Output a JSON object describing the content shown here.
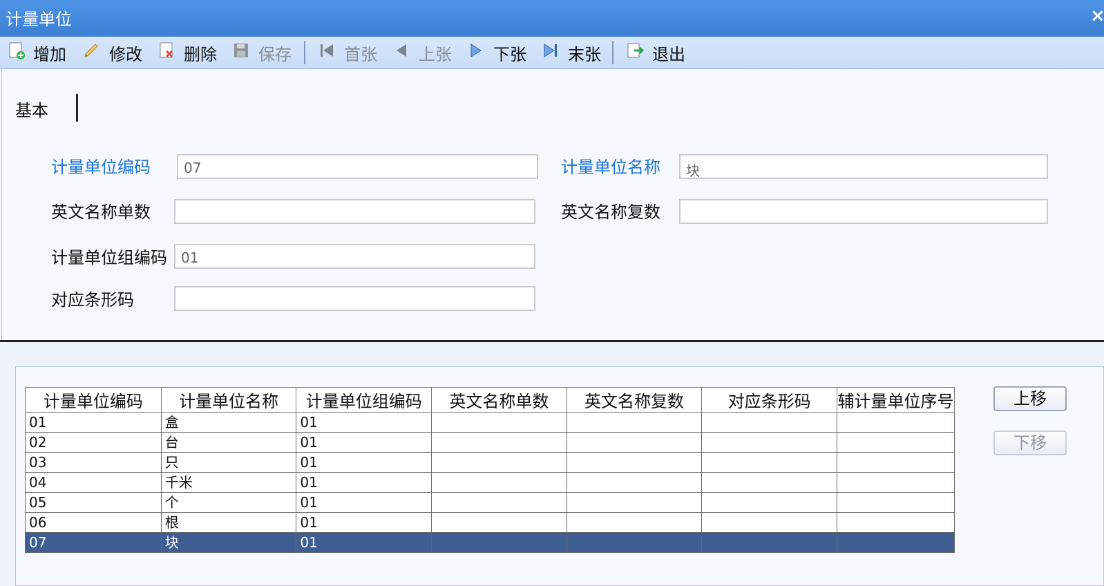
{
  "window": {
    "title": "计量单位",
    "close_glyph": "×"
  },
  "toolbar": {
    "add": "增加",
    "edit": "修改",
    "delete": "删除",
    "save": "保存",
    "first": "首张",
    "prev": "上张",
    "next": "下张",
    "last": "末张",
    "exit": "退出"
  },
  "tab": {
    "basic": "基本"
  },
  "form": {
    "unit_code_label": "计量单位编码",
    "unit_code_value": "07",
    "unit_name_label": "计量单位名称",
    "unit_name_value": "块",
    "en_singular_label": "英文名称单数",
    "en_singular_value": "",
    "en_plural_label": "英文名称复数",
    "en_plural_value": "",
    "group_code_label": "计量单位组编码",
    "group_code_value": "01",
    "barcode_label": "对应条形码",
    "barcode_value": ""
  },
  "grid": {
    "headers": [
      "计量单位编码",
      "计量单位名称",
      "计量单位组编码",
      "英文名称单数",
      "英文名称复数",
      "对应条形码",
      "辅计量单位序号"
    ],
    "rows": [
      [
        "01",
        "盒",
        "01",
        "",
        "",
        "",
        ""
      ],
      [
        "02",
        "台",
        "01",
        "",
        "",
        "",
        ""
      ],
      [
        "03",
        "只",
        "01",
        "",
        "",
        "",
        ""
      ],
      [
        "04",
        "千米",
        "01",
        "",
        "",
        "",
        ""
      ],
      [
        "05",
        "个",
        "01",
        "",
        "",
        "",
        ""
      ],
      [
        "06",
        "根",
        "01",
        "",
        "",
        "",
        ""
      ],
      [
        "07",
        "块",
        "01",
        "",
        "",
        "",
        ""
      ]
    ]
  },
  "buttons": {
    "move_up": "上移",
    "move_down": "下移"
  },
  "colors": {
    "title_blue": "#3c7fd5",
    "selected_row": "#3f5f94",
    "required_label": "#1f74d8"
  },
  "icons": [
    "add-icon",
    "edit-icon",
    "delete-icon",
    "save-icon",
    "first-icon",
    "prev-icon",
    "next-icon",
    "last-icon",
    "exit-icon",
    "close-icon"
  ]
}
